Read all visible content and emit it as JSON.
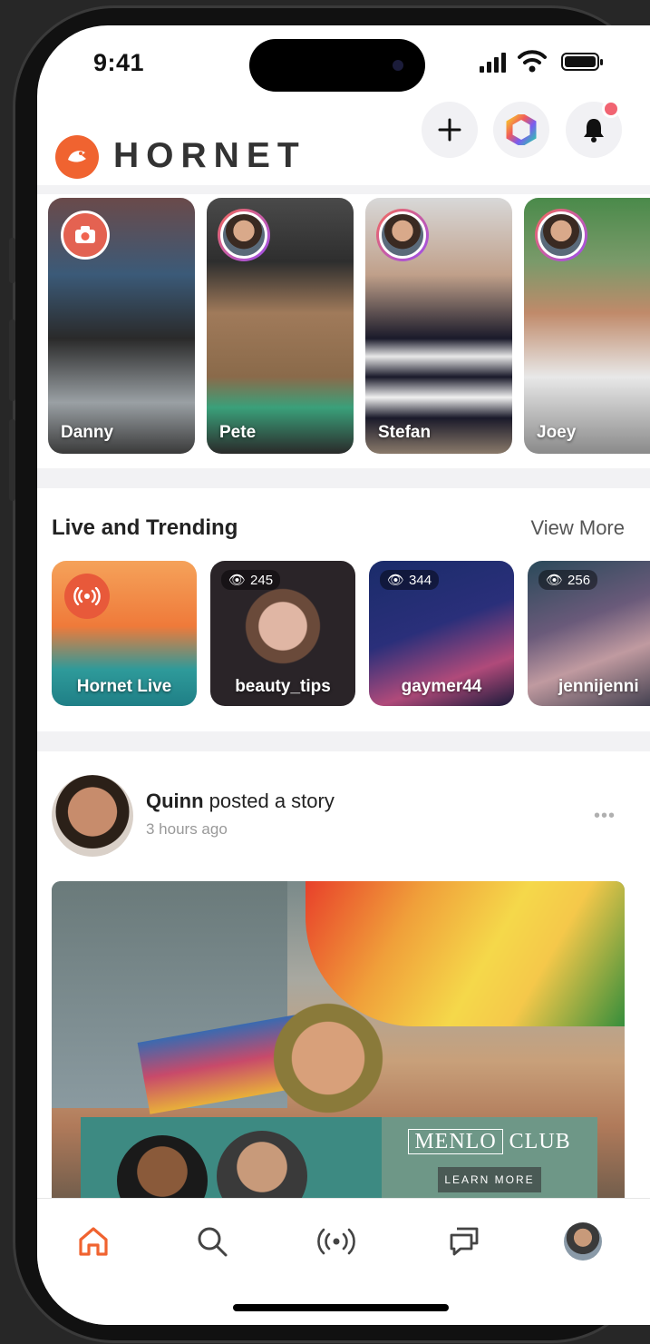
{
  "status_bar": {
    "time": "9:41",
    "icons": [
      "signal-icon",
      "wifi-icon",
      "battery-icon"
    ]
  },
  "header": {
    "brand": "HORNET",
    "buttons": [
      "add-icon",
      "hornet-prism-icon",
      "bell-icon"
    ],
    "notification_dot": true
  },
  "stories": [
    {
      "name": "Danny",
      "badge": "camera-icon"
    },
    {
      "name": "Pete"
    },
    {
      "name": "Stefan"
    },
    {
      "name": "Joey"
    }
  ],
  "live": {
    "title": "Live and Trending",
    "view_more": "View More",
    "items": [
      {
        "name": "Hornet Live",
        "badge": "live-broadcast-icon"
      },
      {
        "name": "beauty_tips",
        "viewers": "245"
      },
      {
        "name": "gaymer44",
        "viewers": "344"
      },
      {
        "name": "jennijenni",
        "viewers": "256"
      }
    ]
  },
  "post": {
    "author": "Quinn",
    "action": " posted a story",
    "time": "3 hours ago",
    "more": "•••"
  },
  "ad": {
    "brand_left": "MENLO",
    "brand_right": "CLUB",
    "cta": "LEARN MORE"
  },
  "tabbar": {
    "items": [
      "home-icon",
      "search-icon",
      "live-icon",
      "chat-icon",
      "profile-avatar"
    ],
    "active": "home-icon"
  },
  "colors": {
    "accent": "#f06330",
    "notification": "#f16472"
  }
}
